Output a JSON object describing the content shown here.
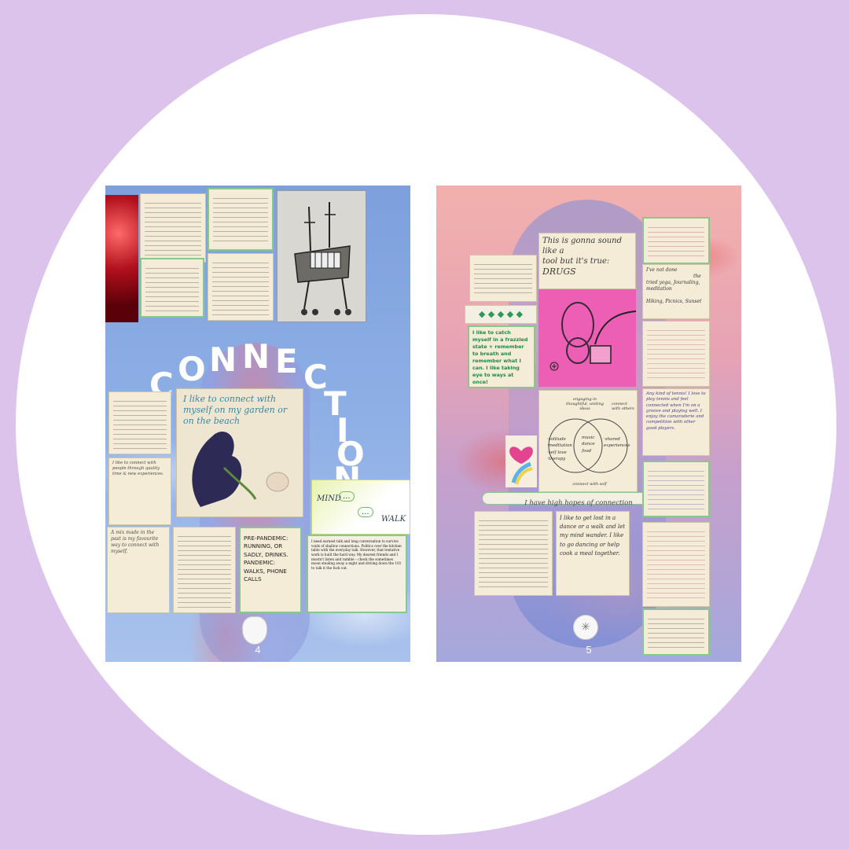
{
  "spread": {
    "left": {
      "page_number": "4",
      "title": "CONNECTION",
      "photo_note": "I like to connect with myself on my garden or on the beach",
      "mind_walk": [
        "MIND",
        "...",
        "...",
        "WALK"
      ],
      "pandemic_note": [
        "PRE-PANDEMIC:",
        "RUNNING, OR",
        "SADLY, DRINKS.",
        "PANDEMIC:",
        "WALKS, PHONE",
        "CALLS"
      ],
      "music_note": "A mix made in the past is my favourite way to connect with myself.",
      "learning_note": "I like to connect with people through quality time & new experiences.",
      "newsprint": "I need earnest talk and long conversation to survive voids of shallow connections. Politics over the kitchen table with the everyday talk. However, that tentative work is built the hard way. My dearest friends and I mustn't listen and ramble – check the sometimes moon stealing away a night and driving down the 101 to talk it the fuck out."
    },
    "right": {
      "page_number": "5",
      "drugs_note": [
        "This is gonna sound like a",
        "tool but it's true:",
        "DRUGS"
      ],
      "green_note": "I like to catch myself in a frazzled state + remember to breath and remember what I can. I like taking eye to ways at once!",
      "ribbon": "I have high hopes of connection",
      "venn": {
        "left": [
          "·solitude",
          "·meditation",
          "·self love",
          "·therapy"
        ],
        "middle": [
          "music",
          "dance",
          "food"
        ],
        "right": [
          "·shared",
          "experiences"
        ],
        "top_curve": "engaging in thoughtful, uniting ideas",
        "right_curve": "connect with others",
        "bottom_curve": "connect with self"
      },
      "tried_note": [
        "I've not done",
        "the",
        "tried yoga, Journaling,",
        "meditation",
        "Hiking, Picnics, Sunset"
      ],
      "tennis_note": "Any kind of tennis! I love to play tennis and feel connected when I'm on a groove and playing well. I enjoy the camaraderie and competition with other good players.",
      "lost_note": "I like to get lost in a dance or a walk and let my mind wander. I like to go dancing or help cook a meal together."
    }
  }
}
